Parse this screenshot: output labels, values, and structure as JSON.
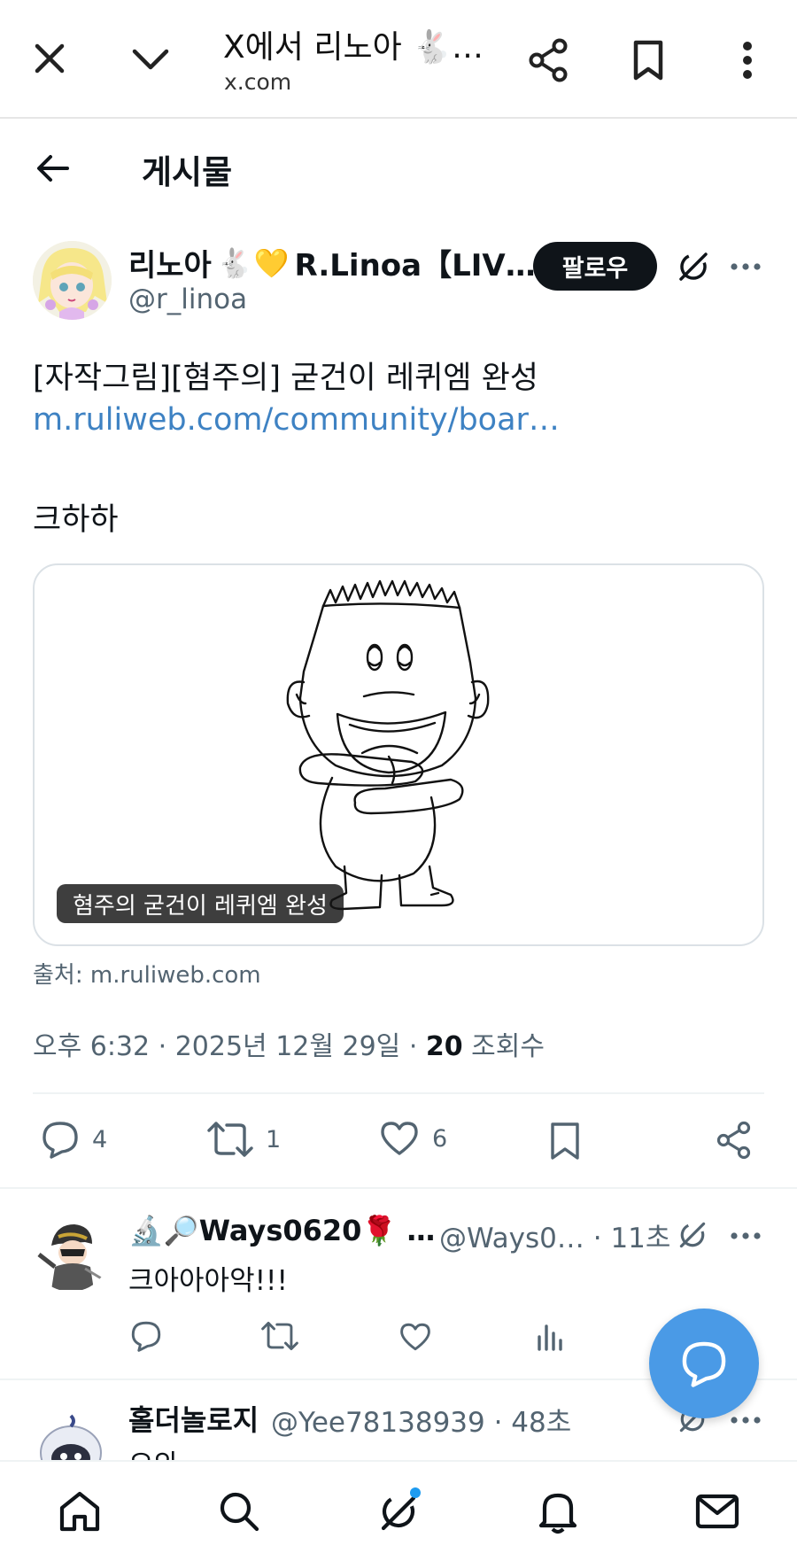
{
  "browser": {
    "title": "X에서 리노아 🐇…",
    "url": "x.com"
  },
  "header": {
    "title": "게시물"
  },
  "post": {
    "author_name": "리노아",
    "author_name_suffix": "R.Linoa【LIV…",
    "author_emojis": [
      "🐇",
      "💛"
    ],
    "handle": "@r_linoa",
    "follow_label": "팔로우",
    "text_line1": "[자작그림][혐주의] 굳건이 레퀴엠 완성",
    "link_text": "m.ruliweb.com/community/boar…",
    "text_line2": "크하하",
    "card_caption": "혐주의 굳건이 레퀴엠 완성",
    "card_source": "출처: m.ruliweb.com",
    "meta_prefix": "오후 6:32 · 2025년 12월 29일 · ",
    "views_count": "20",
    "views_label": " 조회수",
    "replies_count": "4",
    "reposts_count": "1",
    "likes_count": "6"
  },
  "replies": [
    {
      "name": "🔬🔎Ways0620🌹 …",
      "meta": "@Ways0… · 11초",
      "text": "크아아아악!!!"
    },
    {
      "name": "홀더놀로지",
      "meta": "@Yee78138939 · 48초",
      "text": "오와"
    }
  ],
  "colors": {
    "accent": "#1d9bf0",
    "link": "#3e82c3",
    "fab": "#4a9ae6",
    "text_secondary": "#536471"
  },
  "icons": {
    "close": "close-icon",
    "chevron": "chevron-down-icon",
    "share": "share-icon",
    "bookmark": "bookmark-icon",
    "more": "more-vertical-icon",
    "back": "arrow-left-icon",
    "grok": "grok-icon",
    "reply": "reply-icon",
    "repost": "repost-icon",
    "like": "heart-icon",
    "views": "views-icon",
    "compose": "compose-reply-icon",
    "home": "home-icon",
    "search": "search-icon",
    "notifications": "bell-icon",
    "messages": "mail-icon"
  }
}
